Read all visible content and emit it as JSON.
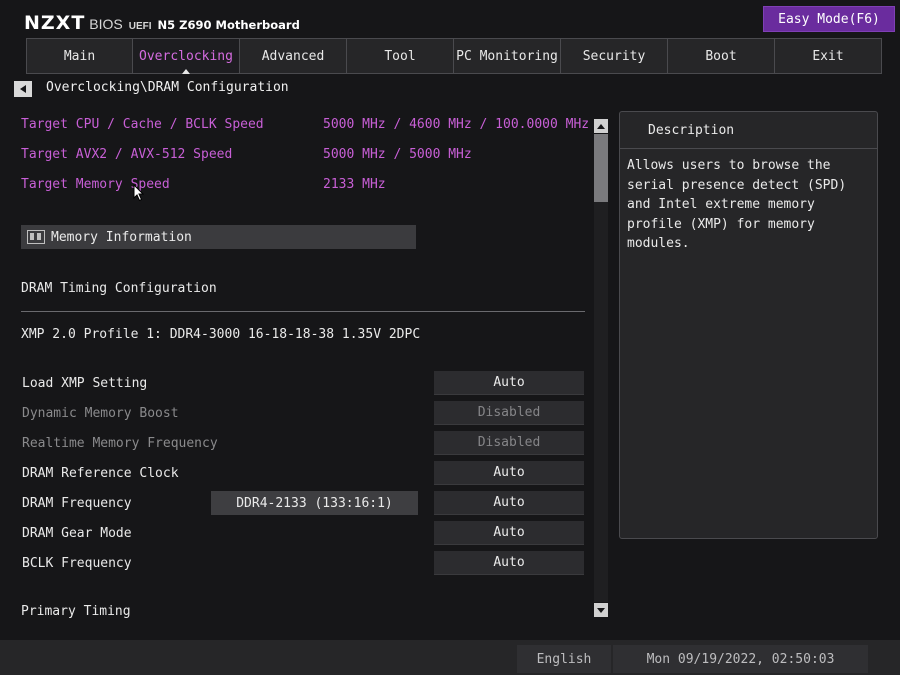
{
  "header": {
    "brand": "NZXT",
    "bios_label": "BIOS",
    "uefi_label": "UEFI",
    "model": "N5 Z690 Motherboard",
    "easy_mode_button": "Easy Mode(F6)"
  },
  "tabs": [
    {
      "label": "Main",
      "active": false
    },
    {
      "label": "Overclocking",
      "active": true
    },
    {
      "label": "Advanced",
      "active": false
    },
    {
      "label": "Tool",
      "active": false
    },
    {
      "label": "PC Monitoring",
      "active": false
    },
    {
      "label": "Security",
      "active": false
    },
    {
      "label": "Boot",
      "active": false
    },
    {
      "label": "Exit",
      "active": false
    }
  ],
  "breadcrumb": "Overclocking\\DRAM Configuration",
  "targets": [
    {
      "label": "Target CPU / Cache / BCLK Speed",
      "value": "5000 MHz / 4600 MHz / 100.0000 MHz"
    },
    {
      "label": "Target AVX2 / AVX-512 Speed",
      "value": "5000 MHz / 5000 MHz"
    },
    {
      "label": "Target Memory Speed",
      "value": "2133 MHz"
    }
  ],
  "memory_information": "Memory Information",
  "dram_timing_heading": "DRAM Timing Configuration",
  "xmp_profile": "XMP 2.0 Profile 1: DDR4-3000 16-18-18-38 1.35V 2DPC",
  "settings": [
    {
      "label": "Load XMP Setting",
      "value": "Auto",
      "enabled": true
    },
    {
      "label": "Dynamic Memory Boost",
      "value": "Disabled",
      "enabled": false
    },
    {
      "label": "Realtime Memory Frequency",
      "value": "Disabled",
      "enabled": false
    },
    {
      "label": "DRAM Reference Clock",
      "value": "Auto",
      "enabled": true
    },
    {
      "label": "DRAM Frequency",
      "value": "Auto",
      "enabled": true
    },
    {
      "label": "DRAM Gear Mode",
      "value": "Auto",
      "enabled": true
    },
    {
      "label": "BCLK Frequency",
      "value": "Auto",
      "enabled": true
    }
  ],
  "dram_frequency_info": "DDR4-2133 (133:16:1)",
  "primary_timing": "Primary Timing",
  "description": {
    "title": "Description",
    "text": "Allows users to browse the serial presence detect (SPD) and Intel extreme memory profile (XMP) for memory modules."
  },
  "footer": {
    "language": "English",
    "datetime": "Mon 09/19/2022, 02:50:03"
  },
  "colors": {
    "accent": "#c85fd6",
    "easy_mode_bg": "#6a2c9e",
    "background": "#161618"
  }
}
